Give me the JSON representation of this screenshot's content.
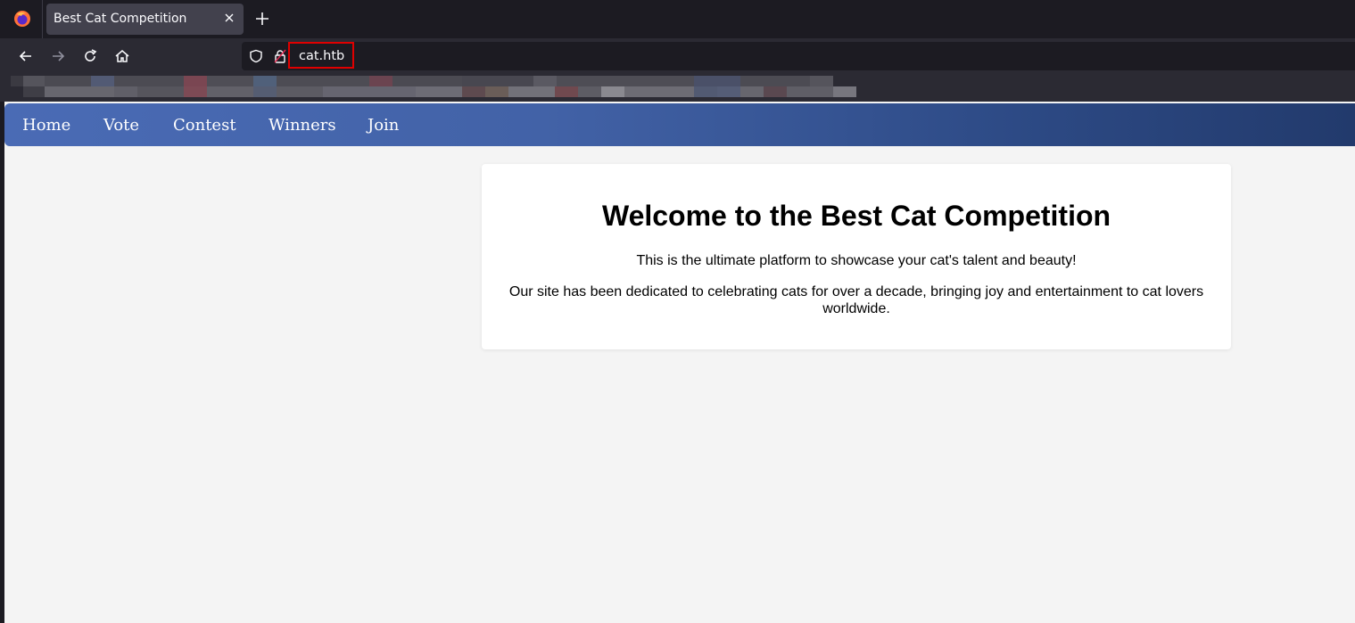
{
  "browser": {
    "tab": {
      "title": "Best Cat Competition"
    },
    "url": "cat.htb",
    "icons": [
      "firefox-logo",
      "close-icon",
      "plus-icon",
      "back-arrow-icon",
      "forward-arrow-icon",
      "reload-icon",
      "home-icon",
      "shield-icon",
      "lock-icon"
    ]
  },
  "site": {
    "nav": [
      "Home",
      "Vote",
      "Contest",
      "Winners",
      "Join"
    ],
    "colors": {
      "nav_start": "#4a6bb5",
      "nav_end": "#223a6c",
      "background": "#f4f4f4"
    },
    "welcome": {
      "heading": "Welcome to the Best Cat Competition",
      "line1": "This is the ultimate platform to showcase your cat's talent and beauty!",
      "line2": "Our site has been dedicated to celebrating cats for over a decade, bringing joy and entertainment to cat lovers worldwide."
    }
  }
}
